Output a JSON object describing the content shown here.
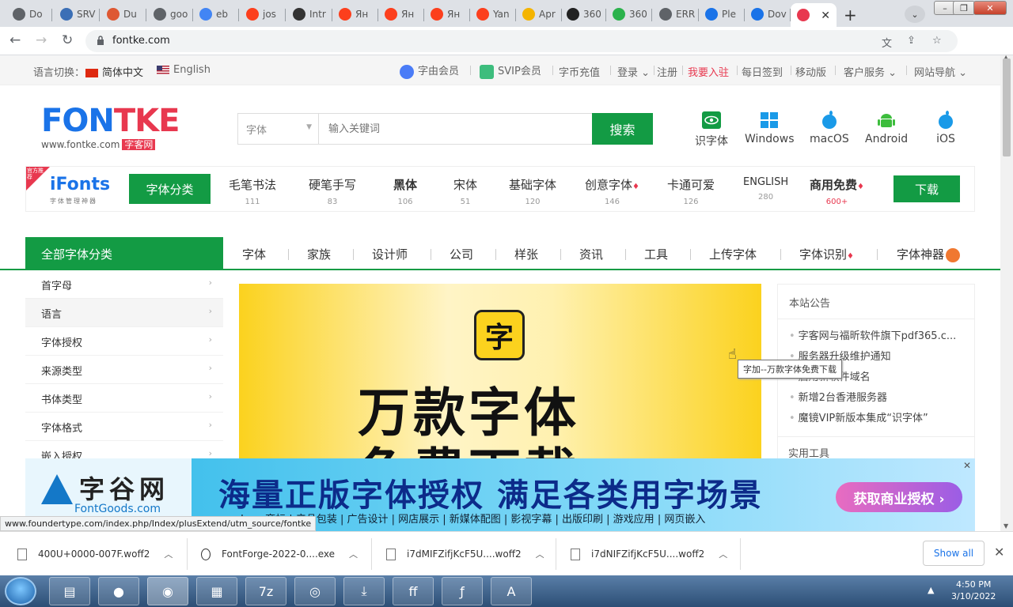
{
  "browser": {
    "tabs": [
      {
        "label": "Do",
        "fav_color": "#5f6368"
      },
      {
        "label": "SRV",
        "fav_color": "#3b6fb6"
      },
      {
        "label": "Du",
        "fav_color": "#de5833"
      },
      {
        "label": "goo",
        "fav_color": "#5f6368"
      },
      {
        "label": "eb",
        "fav_color": "#4285f4"
      },
      {
        "label": "jos",
        "fav_color": "#fc3f1d"
      },
      {
        "label": "Intr",
        "fav_color": "#333333"
      },
      {
        "label": "Ян",
        "fav_color": "#fc3f1d"
      },
      {
        "label": "Ян",
        "fav_color": "#fc3f1d"
      },
      {
        "label": "Ян",
        "fav_color": "#fc3f1d"
      },
      {
        "label": "Yan",
        "fav_color": "#fc3f1d"
      },
      {
        "label": "Apr",
        "fav_color": "#f4b400"
      },
      {
        "label": "360",
        "fav_color": "#222222"
      },
      {
        "label": "360",
        "fav_color": "#2bb24c"
      },
      {
        "label": "ERR",
        "fav_color": "#5f6368"
      },
      {
        "label": "Ple",
        "fav_color": "#1a73e8"
      },
      {
        "label": "Dov",
        "fav_color": "#1a73e8"
      },
      {
        "label": "",
        "fav_color": "#e8384f"
      }
    ],
    "new_tab": "+",
    "url": "fontke.com",
    "minimize": "–",
    "restore": "❐",
    "close": "✕"
  },
  "util": {
    "lang_switch": "语言切换：",
    "lang_cn": "简体中文",
    "lang_en": "English",
    "vip1": "字由会员",
    "vip2": "SVIP会员",
    "recharge": "字币充值",
    "login": "登录",
    "register": "注册",
    "join": "我要入驻",
    "checkin": "每日签到",
    "mobile": "移动版",
    "service": "客户服务",
    "sitenav": "网站导航"
  },
  "header": {
    "logo_text": "FONTKE",
    "logo_sub": "www.fontke.com",
    "logo_sub_cn": "字客网",
    "search_category": "字体",
    "search_placeholder": "输入关键词",
    "search_button": "搜索",
    "platforms": [
      "识字体",
      "Windows",
      "macOS",
      "Android",
      "iOS"
    ]
  },
  "categories": {
    "badge": "官方推荐",
    "ifonts": "iFonts",
    "ifonts_tag": "字体管理神器",
    "button": "字体分类",
    "items": [
      {
        "name": "毛笔书法",
        "count": "111"
      },
      {
        "name": "硬笔手写",
        "count": "83"
      },
      {
        "name": "黑体",
        "count": "106"
      },
      {
        "name": "宋体",
        "count": "51"
      },
      {
        "name": "基础字体",
        "count": "120"
      },
      {
        "name": "创意字体",
        "count": "146"
      },
      {
        "name": "卡通可爱",
        "count": "126"
      },
      {
        "name": "ENGLISH",
        "count": "280"
      },
      {
        "name": "商用免费",
        "count": "600+"
      }
    ],
    "download": "下载"
  },
  "nav": {
    "all": "全部字体分类",
    "links": [
      "字体",
      "家族",
      "设计师",
      "公司",
      "样张",
      "资讯",
      "工具",
      "上传字体",
      "字体识别",
      "字体神器"
    ]
  },
  "sidebar": {
    "items": [
      "首字母",
      "语言",
      "字体授权",
      "来源类型",
      "书体类型",
      "字体格式",
      "嵌入授权"
    ]
  },
  "banner": {
    "logo": "字",
    "line1": "万款字体",
    "line2": "免费下载"
  },
  "notice": {
    "title": "本站公告",
    "items": [
      "字客网与福昕软件旗下pdf365.c...",
      "服务器升级维护通知",
      "启用新软件域名",
      "新增2台香港服务器",
      "魔镜VIP新版本集成“识字体”"
    ],
    "tooltip": "字加--万款字体免费下载",
    "next_title": "实用工具"
  },
  "ad": {
    "logo_cn": "字谷网",
    "logo_en": "FontGoods.com",
    "headline": "海量正版字体授权  满足各类用字场景",
    "sub": "Logo商标 | 产品包装 | 广告设计 | 网店展示 | 新媒体配图 | 影视字幕 | 出版印刷 | 游戏应用 | 网页嵌入",
    "button": "获取商业授权 ›",
    "close": "✕"
  },
  "status_url": "www.foundertype.com/index.php/Index/plusExtend/utm_source/fontke",
  "downloads": {
    "items": [
      "400U+0000-007F.woff2",
      "FontForge-2022-0....exe",
      "i7dMIFZifjKcF5U....woff2",
      "i7dNIFZifjKcF5U....woff2"
    ],
    "show_all": "Show all"
  },
  "taskbar": {
    "time": "4:50 PM",
    "date": "3/10/2022"
  }
}
